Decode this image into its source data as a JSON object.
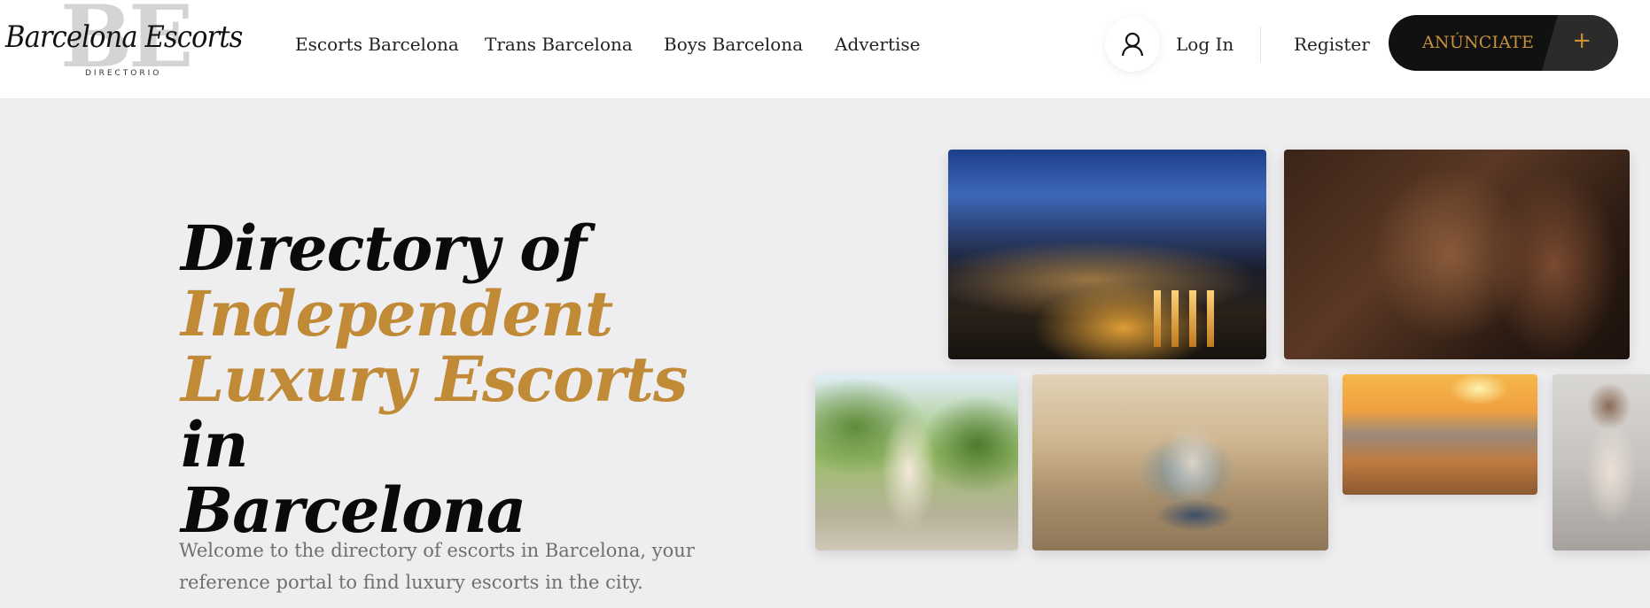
{
  "brand": {
    "monogram": "BE",
    "name": "Barcelona Escorts",
    "tagline": "DIRECTORIO"
  },
  "nav": {
    "items": [
      {
        "label": "Escorts Barcelona"
      },
      {
        "label": "Trans Barcelona"
      },
      {
        "label": "Boys Barcelona"
      },
      {
        "label": "Advertise"
      }
    ]
  },
  "account": {
    "login_label": "Log In",
    "register_label": "Register",
    "cta_label": "ANÚNCIATE",
    "cta_plus": "+"
  },
  "hero": {
    "title_line1": "Directory of",
    "title_gold_1": "Independent",
    "title_gold_2": "Luxury Escorts",
    "title_in": " in",
    "title_line4": "Barcelona",
    "text": "Welcome to the directory of escorts in Barcelona, your reference portal to find luxury escorts in the city."
  },
  "colors": {
    "accent": "#c08a36",
    "background": "#eeeef0",
    "cta_bg": "#111111"
  }
}
